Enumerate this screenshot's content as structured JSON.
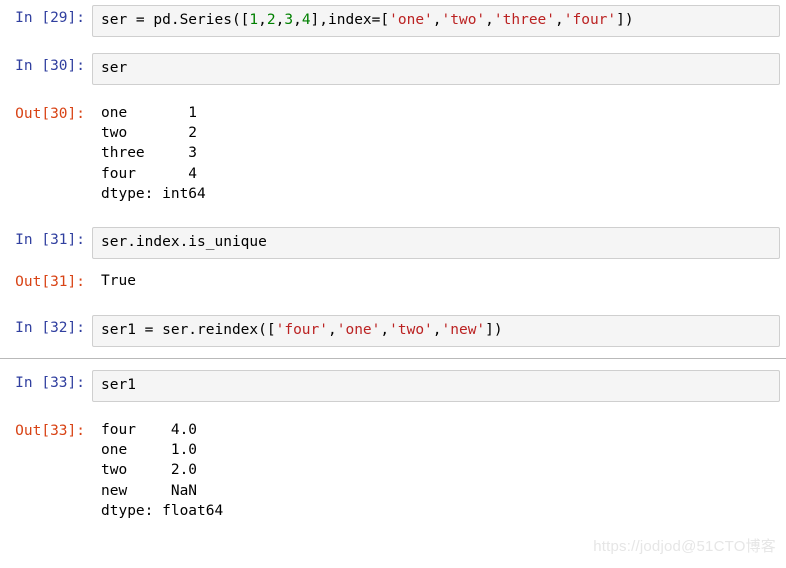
{
  "notebook": {
    "cells": [
      {
        "type": "input",
        "prompt": "In [29]:",
        "tokens": [
          {
            "t": "plain",
            "v": "ser = pd.Series(["
          },
          {
            "t": "num",
            "v": "1"
          },
          {
            "t": "plain",
            "v": ","
          },
          {
            "t": "num",
            "v": "2"
          },
          {
            "t": "plain",
            "v": ","
          },
          {
            "t": "num",
            "v": "3"
          },
          {
            "t": "plain",
            "v": ","
          },
          {
            "t": "num",
            "v": "4"
          },
          {
            "t": "plain",
            "v": "],index=["
          },
          {
            "t": "str",
            "v": "'one'"
          },
          {
            "t": "plain",
            "v": ","
          },
          {
            "t": "str",
            "v": "'two'"
          },
          {
            "t": "plain",
            "v": ","
          },
          {
            "t": "str",
            "v": "'three'"
          },
          {
            "t": "plain",
            "v": ","
          },
          {
            "t": "str",
            "v": "'four'"
          },
          {
            "t": "plain",
            "v": "])"
          }
        ]
      },
      {
        "type": "input",
        "prompt": "In [30]:",
        "tokens": [
          {
            "t": "plain",
            "v": "ser"
          }
        ]
      },
      {
        "type": "output",
        "prompt": "Out[30]:",
        "text": "one       1\ntwo       2\nthree     3\nfour      4\ndtype: int64"
      },
      {
        "type": "input",
        "prompt": "In [31]:",
        "tokens": [
          {
            "t": "plain",
            "v": "ser.index.is_unique"
          }
        ]
      },
      {
        "type": "output",
        "prompt": "Out[31]:",
        "text": "True"
      },
      {
        "type": "input",
        "prompt": "In [32]:",
        "tokens": [
          {
            "t": "plain",
            "v": "ser1 = ser.reindex(["
          },
          {
            "t": "str",
            "v": "'four'"
          },
          {
            "t": "plain",
            "v": ","
          },
          {
            "t": "str",
            "v": "'one'"
          },
          {
            "t": "plain",
            "v": ","
          },
          {
            "t": "str",
            "v": "'two'"
          },
          {
            "t": "plain",
            "v": ","
          },
          {
            "t": "str",
            "v": "'new'"
          },
          {
            "t": "plain",
            "v": "])"
          }
        ]
      },
      {
        "type": "input",
        "prompt": "In [33]:",
        "tokens": [
          {
            "t": "plain",
            "v": "ser1"
          }
        ]
      },
      {
        "type": "output",
        "prompt": "Out[33]:",
        "text": "four    4.0\none     1.0\ntwo     2.0\nnew     NaN\ndtype: float64"
      }
    ]
  },
  "watermark": {
    "text": "https://jodjod@51CTO博客"
  },
  "colors": {
    "in_prompt": "#303f9f",
    "out_prompt": "#d84315",
    "string_literal": "#bb2222",
    "number_literal": "#008000",
    "input_background": "#f5f5f5",
    "input_border": "#cfcfcf",
    "divider": "#b9b9b9",
    "page_background": "#ffffff"
  }
}
